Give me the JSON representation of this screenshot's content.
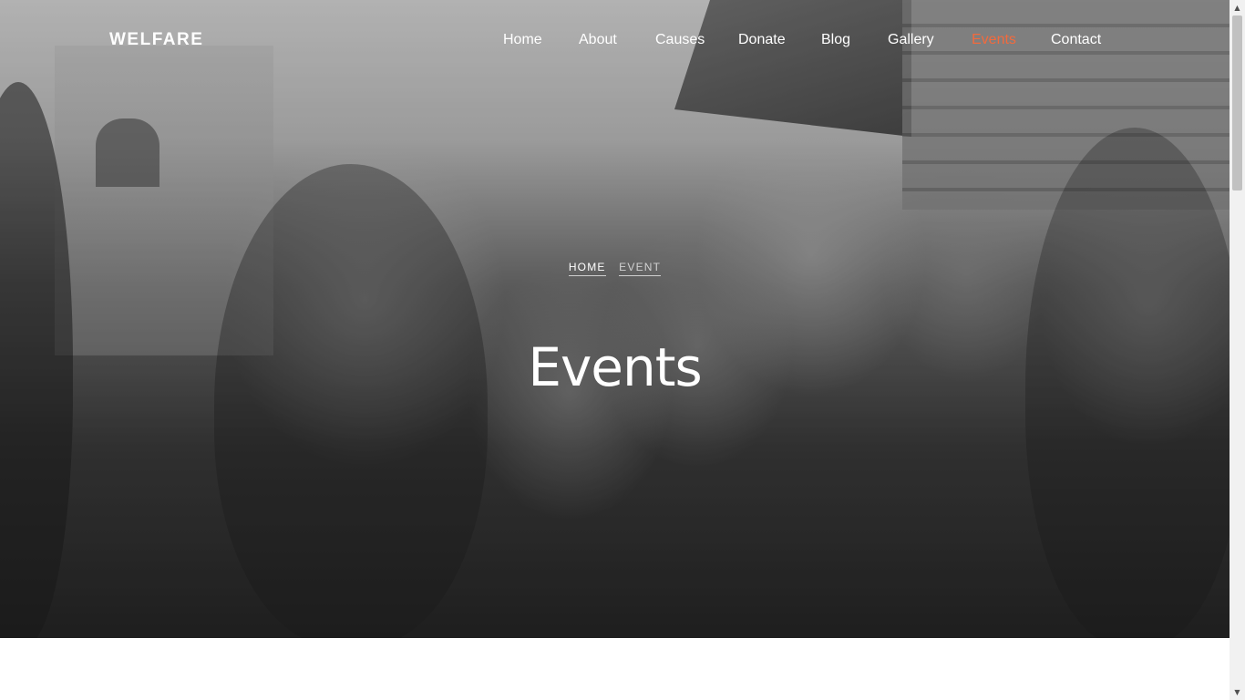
{
  "brand": {
    "logo_text": "WELFARE"
  },
  "nav": {
    "items": [
      {
        "label": "Home"
      },
      {
        "label": "About"
      },
      {
        "label": "Causes"
      },
      {
        "label": "Donate"
      },
      {
        "label": "Blog"
      },
      {
        "label": "Gallery"
      },
      {
        "label": "Events",
        "active": true
      },
      {
        "label": "Contact"
      }
    ],
    "active_color": "#f26a3d"
  },
  "hero": {
    "breadcrumb": {
      "home": "HOME",
      "current": "EVENT"
    },
    "title": "Events",
    "image": "children-group-photo"
  }
}
